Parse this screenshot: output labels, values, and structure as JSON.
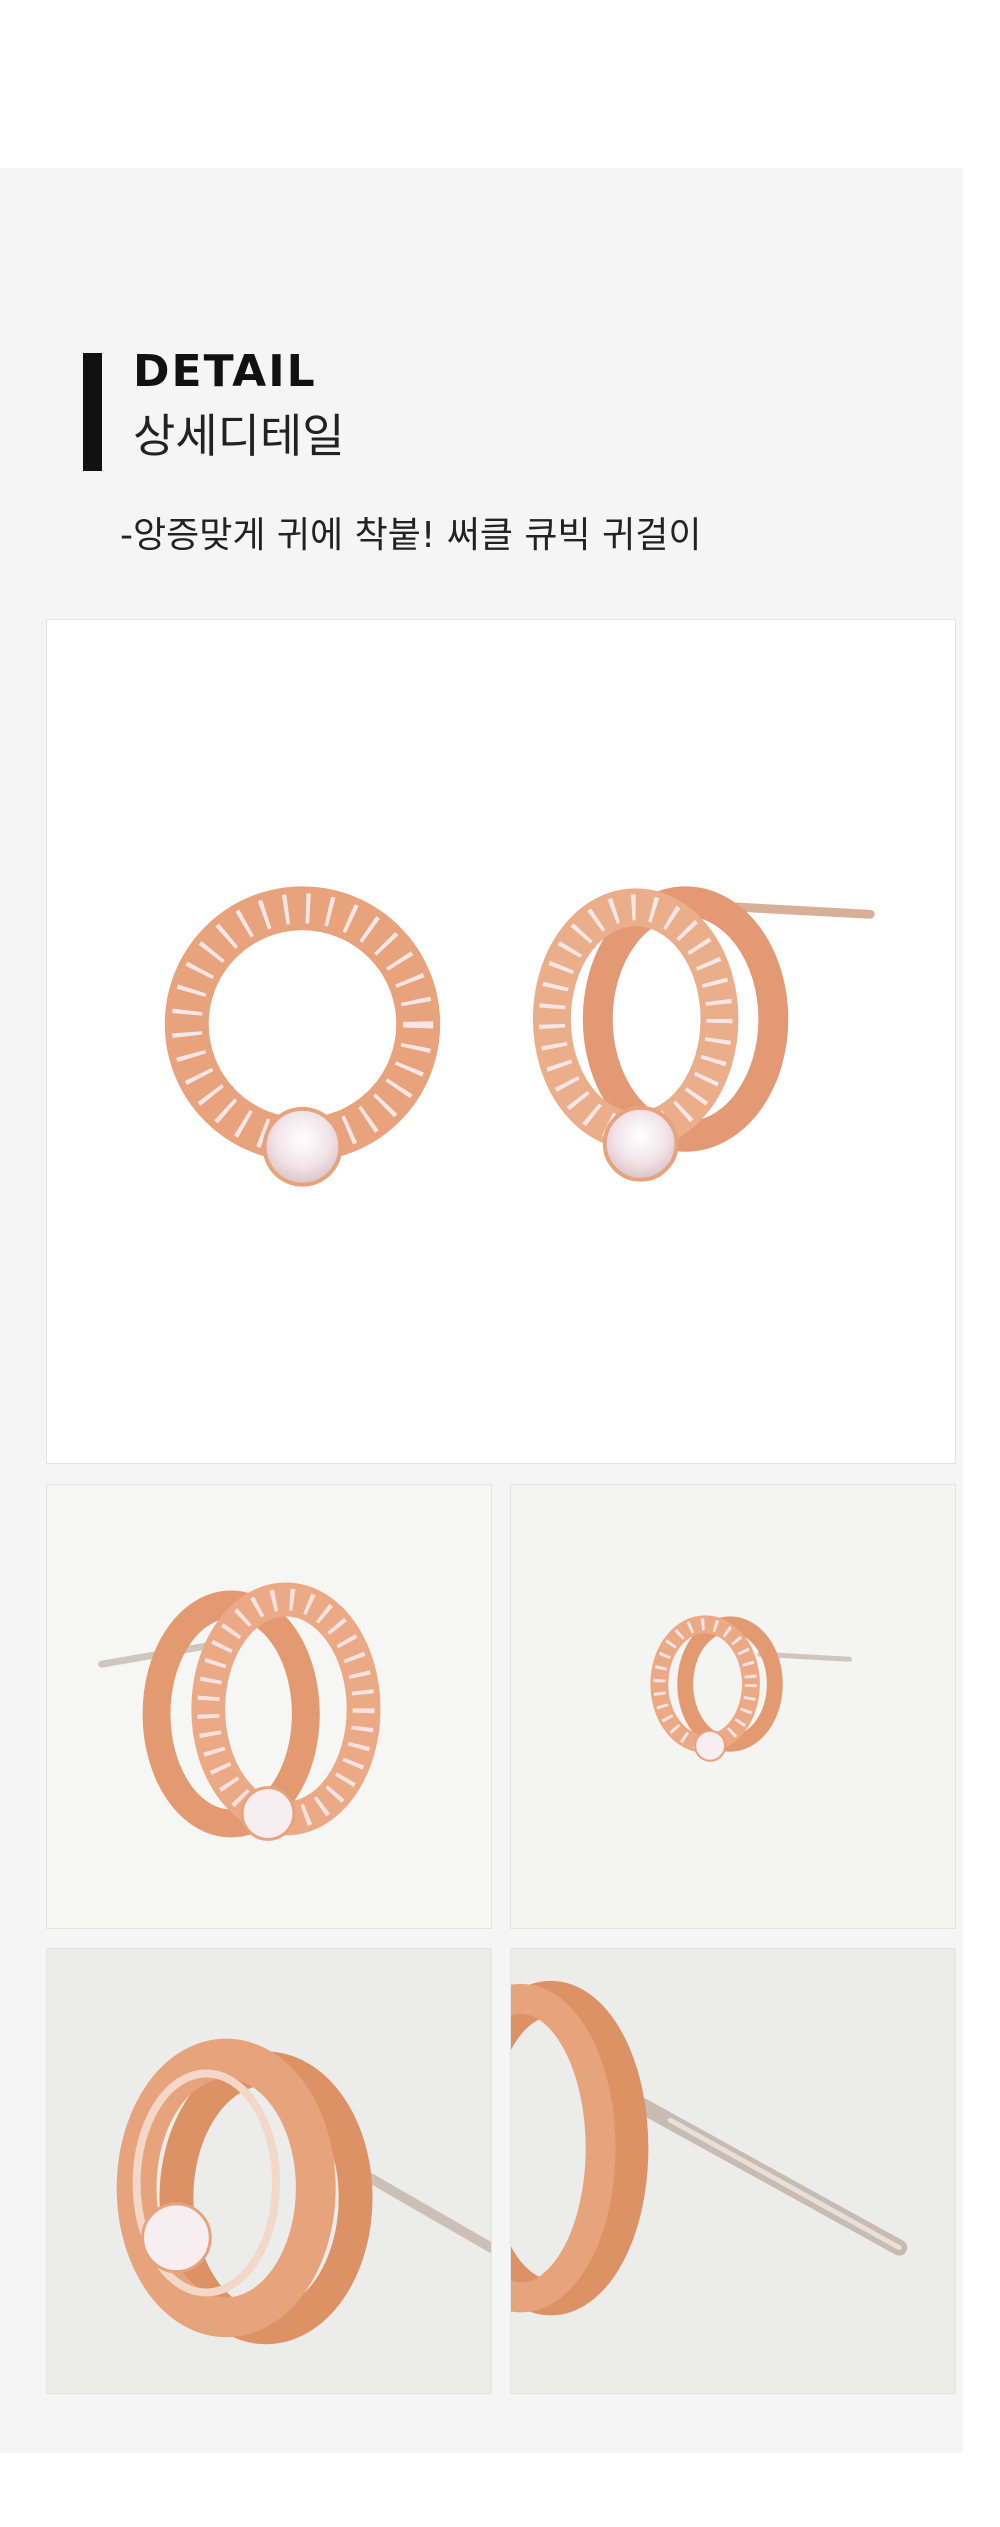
{
  "detail": {
    "title_en": "DETAIL",
    "title_ko": "상세디테일",
    "description": "-앙증맞게 귀에 착붙! 써클 큐빅 귀걸이"
  },
  "colors": {
    "panel_background": "#f5f5f5",
    "heading_bar": "#111111",
    "rose_gold": "#e8a27c",
    "crystal": "#f6eef0"
  },
  "photos": [
    {
      "subject": "pair of circle cubic stud earrings, front and side view",
      "icon": "earring-pair-photo"
    },
    {
      "subject": "single earring, angled view with post",
      "icon": "earring-angle-photo"
    },
    {
      "subject": "single earring, small side view",
      "icon": "earring-side-photo"
    },
    {
      "subject": "earring close-up, rose gold rings",
      "icon": "earring-closeup-photo"
    },
    {
      "subject": "earring post close-up",
      "icon": "earring-post-photo"
    }
  ]
}
